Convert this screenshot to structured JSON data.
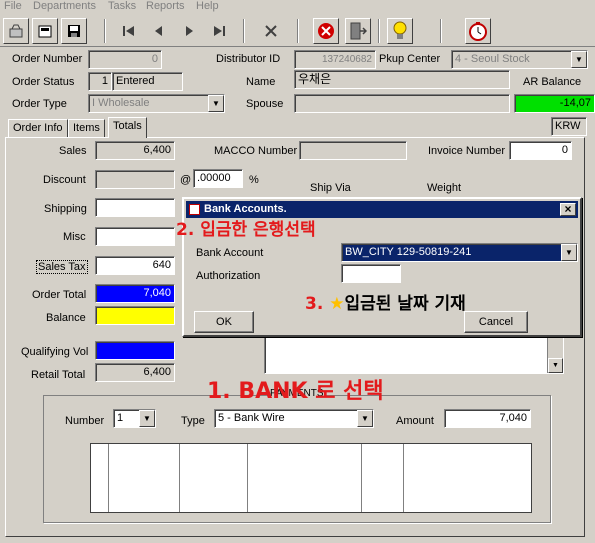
{
  "menu": [
    "File",
    "Departments",
    "Tasks",
    "Reports",
    "Help"
  ],
  "header": {
    "order_number_label": "Order Number",
    "order_number_value": "0",
    "distributor_id_label": "Distributor ID",
    "distributor_id_value": "137240682",
    "pickup_center_label": "Pkup Center",
    "pickup_center_value": "4 - Seoul Stock",
    "order_status_label": "Order Status",
    "order_status_code": "1",
    "order_status_value": "Entered",
    "name_label": "Name",
    "name_value": "우채은",
    "ar_balance_label": "AR Balance",
    "ar_balance_value": "-14,07",
    "order_type_label": "Order Type",
    "order_type_value": "I Wholesale",
    "spouse_label": "Spouse",
    "spouse_value": "",
    "currency": "KRW"
  },
  "tabs": [
    "Order Info",
    "Items",
    "Totals"
  ],
  "totals": {
    "sales_label": "Sales",
    "sales_value": "6,400",
    "macco_label": "MACCO Number",
    "macco_value": "",
    "invoice_label": "Invoice Number",
    "invoice_value": "0",
    "discount_label": "Discount",
    "discount_value": "",
    "at_symbol": "@",
    "discount_rate": ".00000",
    "percent_symbol": "%",
    "ship_via_label": "Ship Via",
    "weight_label": "Weight",
    "shipping_label": "Shipping",
    "shipping_value": "",
    "misc_label": "Misc",
    "misc_value": "",
    "sales_tax_label": "Sales Tax",
    "sales_tax_value": "640",
    "order_total_label": "Order Total",
    "order_total_value": "7,040",
    "balance_label": "Balance",
    "balance_value": "",
    "qualifying_vol_label": "Qualifying Vol",
    "qualifying_vol_value": "",
    "retail_total_label": "Retail Total",
    "retail_total_value": "6,400"
  },
  "payments": {
    "group_label": "PAYMENTS",
    "number_label": "Number",
    "number_value": "1",
    "type_label": "Type",
    "type_value": "5 - Bank Wire",
    "amount_label": "Amount",
    "amount_value": "7,040"
  },
  "dialog": {
    "title": "Bank Accounts.",
    "close": "×",
    "bank_account_label": "Bank Account",
    "bank_account_value": "BW_CITY 129-50819-241",
    "authorization_label": "Authorization",
    "authorization_value": "",
    "ok_label": "OK",
    "cancel_label": "Cancel"
  },
  "annotations": {
    "step1": "1. BANK 로 선택",
    "step2": "2. 입금한 은행선택",
    "step3_prefix": "3. ",
    "step3_star": "★",
    "step3_text": "입금된 날짜 기재"
  },
  "colors": {
    "order_total_bg": "#0000ff",
    "balance_bg": "#ffff00",
    "qualifying_bg": "#0000ff",
    "ar_balance_bg": "#00e000",
    "annotation": "#e31a1c",
    "title_bar": "#0a246a"
  }
}
